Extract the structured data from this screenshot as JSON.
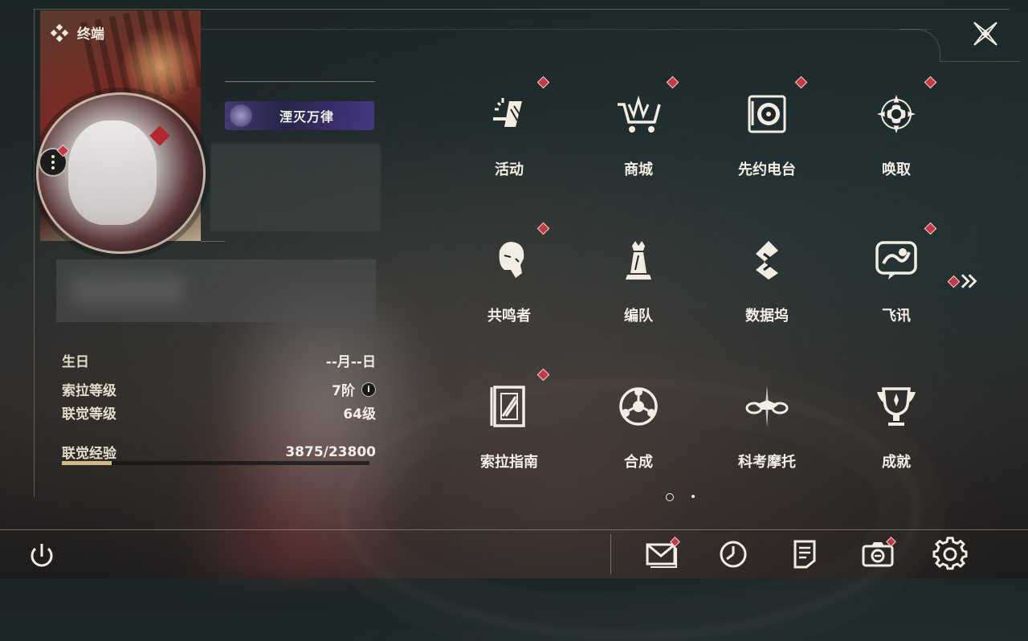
{
  "header": {
    "title": "终端"
  },
  "profile": {
    "title_badge": "湮灭万律",
    "birthday_label": "生日",
    "birthday_value": "--月--日",
    "sola_level_label": "索拉等级",
    "sola_level_value": "7阶",
    "union_level_label": "联觉等级",
    "union_level_value": "64级",
    "union_exp_label": "联觉经验",
    "union_exp_value": "3875/23800",
    "union_exp_progress": 0.163,
    "info_icon_glyph": "i"
  },
  "menu": {
    "items": [
      {
        "label": "活动",
        "icon": "event-icon",
        "badge": true
      },
      {
        "label": "商城",
        "icon": "shop-cart-icon",
        "badge": true
      },
      {
        "label": "先约电台",
        "icon": "radio-icon",
        "badge": true
      },
      {
        "label": "唤取",
        "icon": "convene-icon",
        "badge": true
      },
      {
        "label": "共鸣者",
        "icon": "resonator-icon",
        "badge": true
      },
      {
        "label": "编队",
        "icon": "team-chess-icon",
        "badge": false
      },
      {
        "label": "数据坞",
        "icon": "data-bank-icon",
        "badge": false
      },
      {
        "label": "飞讯",
        "icon": "chat-icon",
        "badge": true
      },
      {
        "label": "索拉指南",
        "icon": "guidebook-icon",
        "badge": true
      },
      {
        "label": "合成",
        "icon": "synthesis-icon",
        "badge": false
      },
      {
        "label": "科考摩托",
        "icon": "motorcycle-icon",
        "badge": false
      },
      {
        "label": "成就",
        "icon": "trophy-icon",
        "badge": false
      }
    ],
    "next_page_icon": "double-chevron-right-icon",
    "pages": 2,
    "current_page": 1
  },
  "bottom_bar": {
    "items": [
      "power-icon",
      "mail-icon",
      "clock-icon",
      "notes-icon",
      "camera-icon",
      "settings-icon"
    ]
  },
  "colors": {
    "accent": "#d2b98b",
    "badge": "#c33a45",
    "text": "#f4efe6"
  }
}
